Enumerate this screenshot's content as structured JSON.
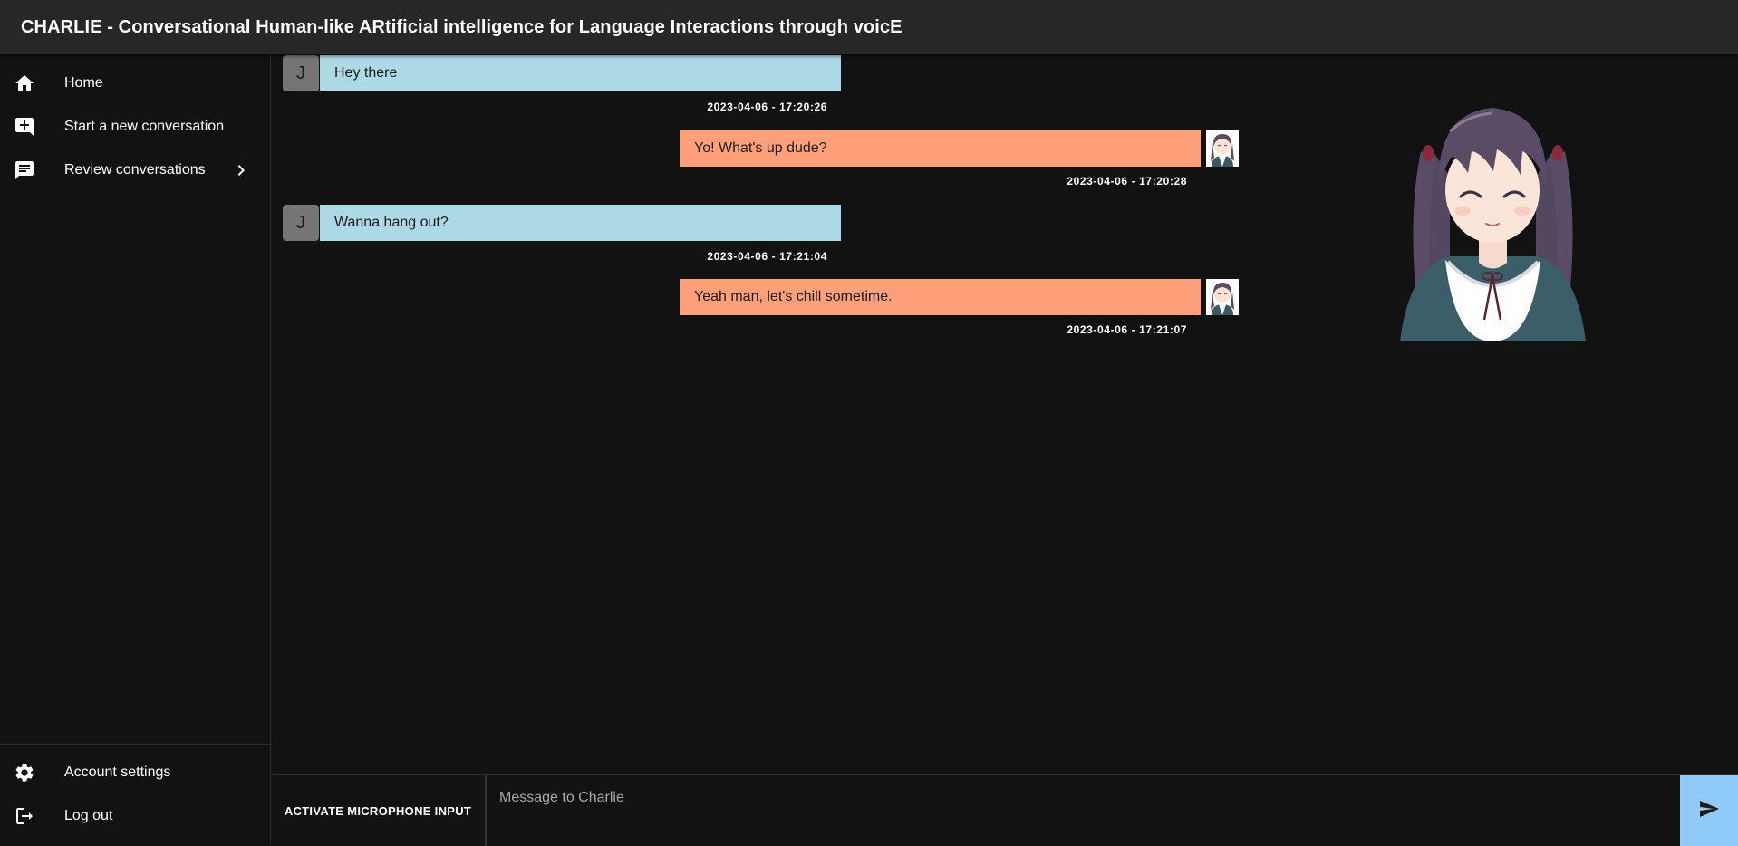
{
  "app": {
    "title": "CHARLIE - Conversational Human-like ARtificial intelligence for Language Interactions through voicE"
  },
  "sidebar": {
    "items": [
      {
        "label": "Home",
        "icon": "home-icon"
      },
      {
        "label": "Start a new conversation",
        "icon": "add-comment-icon"
      },
      {
        "label": "Review conversations",
        "icon": "chat-icon"
      }
    ],
    "bottom_items": [
      {
        "label": "Account settings",
        "icon": "gear-icon"
      },
      {
        "label": "Log out",
        "icon": "logout-icon"
      }
    ]
  },
  "messages": [
    {
      "sender": "user",
      "avatar_initial": "J",
      "text": "Hey there",
      "timestamp": "2023-04-06 - 17:20:26"
    },
    {
      "sender": "charlie",
      "text": "Yo! What's up dude?",
      "timestamp": "2023-04-06 - 17:20:28"
    },
    {
      "sender": "user",
      "avatar_initial": "J",
      "text": "Wanna hang out?",
      "timestamp": "2023-04-06 - 17:21:04"
    },
    {
      "sender": "charlie",
      "text": "Yeah man, let's chill sometime.",
      "timestamp": "2023-04-06 - 17:21:07"
    }
  ],
  "composer": {
    "mic_label": "ACTIVATE MICROPHONE INPUT",
    "placeholder": "Message to Charlie",
    "value": "",
    "send_icon": "send-icon"
  },
  "colors": {
    "user_bubble": "#add8e6",
    "bot_bubble": "#ffa07a",
    "accent": "#90caf9",
    "background": "#121212",
    "appbar": "#272727"
  }
}
